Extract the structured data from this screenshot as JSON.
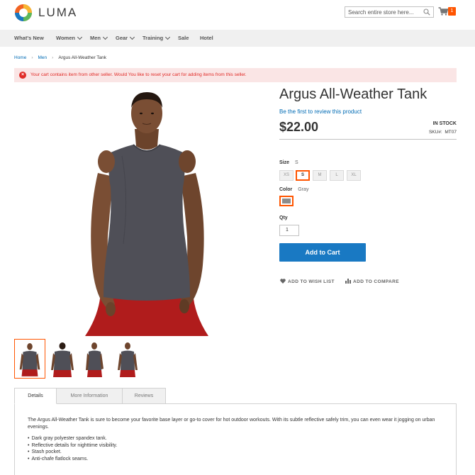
{
  "brand": {
    "name": "LUMA"
  },
  "search": {
    "placeholder": "Search entire store here..."
  },
  "cart": {
    "count": "1"
  },
  "nav": [
    {
      "label": "What's New",
      "dropdown": false
    },
    {
      "label": "Women",
      "dropdown": true
    },
    {
      "label": "Men",
      "dropdown": true
    },
    {
      "label": "Gear",
      "dropdown": true
    },
    {
      "label": "Training",
      "dropdown": true
    },
    {
      "label": "Sale",
      "dropdown": false
    },
    {
      "label": "Hotel",
      "dropdown": false
    }
  ],
  "breadcrumb": [
    "Home",
    "Men",
    "Argus All-Weather Tank"
  ],
  "message": {
    "text": "Your cart contains item from other seller. Would You like to reset your cart for adding items from this seller.",
    "icon": "error-icon"
  },
  "product": {
    "title": "Argus All-Weather Tank",
    "review_link": "Be the first to review this product",
    "price": "$22.00",
    "stock": "IN STOCK",
    "sku_label": "SKU#:",
    "sku": "MT07"
  },
  "options": {
    "size_label": "Size",
    "size_selected": "S",
    "sizes": [
      "XS",
      "S",
      "M",
      "L",
      "XL"
    ],
    "color_label": "Color",
    "color_selected": "Gray",
    "color_hex": "#8c8c8c"
  },
  "qty": {
    "label": "Qty",
    "value": "1"
  },
  "actions": {
    "add_to_cart": "Add to Cart",
    "wish_list": "ADD TO WISH LIST",
    "compare": "ADD TO COMPARE"
  },
  "tabs": [
    "Details",
    "More Information",
    "Reviews"
  ],
  "details": {
    "description": "The Argus All-Weather Tank is sure to become your favorite base layer or go-to cover for hot outdoor workouts. With its subtle reflective safely trim, you can even wear it jogging on urban evenings.",
    "bullets": [
      "Dark gray polyester spandex tank.",
      "Reflective details for nighttime visibility.",
      "Stash pocket.",
      "Anti-chafe flatlock seams."
    ]
  },
  "colors": {
    "accent": "#ff5501",
    "primary_button": "#1979c3",
    "link": "#006bb4",
    "error": "#e02b27"
  }
}
